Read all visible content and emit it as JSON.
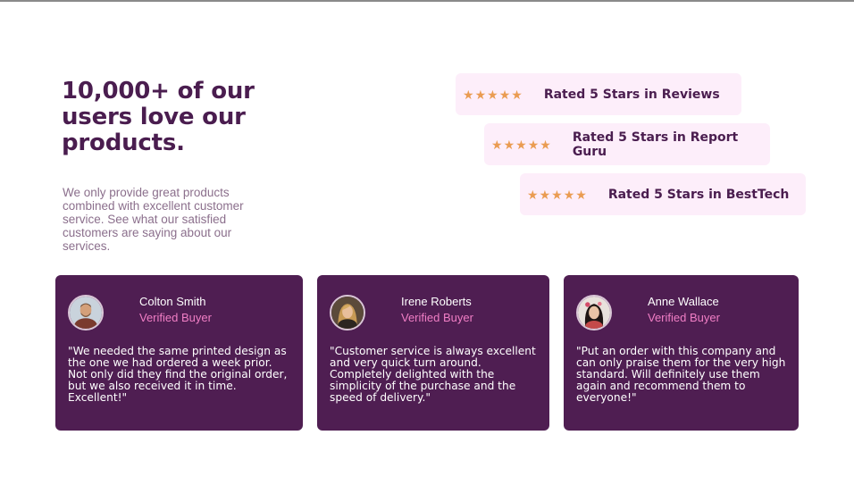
{
  "headline": "10,000+ of our users love our products.",
  "intro": "We only provide great products combined with excellent customer service. See what our satisfied customers are saying about our services.",
  "ratings": [
    {
      "stars": 5,
      "label": "Rated 5 Stars in Reviews"
    },
    {
      "stars": 5,
      "label": "Rated 5 Stars in Report Guru"
    },
    {
      "stars": 5,
      "label": "Rated 5 Stars in BestTech"
    }
  ],
  "testimonials": [
    {
      "name": "Colton Smith",
      "badge": "Verified Buyer",
      "quote": "\"We needed the same printed design as the one we had ordered a week prior. Not only did they find the original order, but we also received it in time. Excellent!\""
    },
    {
      "name": "Irene Roberts",
      "badge": "Verified Buyer",
      "quote": "\"Customer service is always excellent and very quick turn around. Completely delighted with the simplicity of the purchase and the speed of delivery.\""
    },
    {
      "name": "Anne Wallace",
      "badge": "Verified Buyer",
      "quote": "\"Put an order with this company and can only praise them for the very high standard. Will definitely use them again and recommend them to everyone!\""
    }
  ],
  "colors": {
    "primary": "#4a1d4f",
    "card_bg": "#4f1e52",
    "rating_bg": "#fdeefa",
    "star": "#ea9c52",
    "accent_pink": "#f07ec5",
    "muted_text": "#8b6f8c"
  },
  "icons": {
    "star": "star-icon",
    "avatar": "avatar-photo"
  }
}
